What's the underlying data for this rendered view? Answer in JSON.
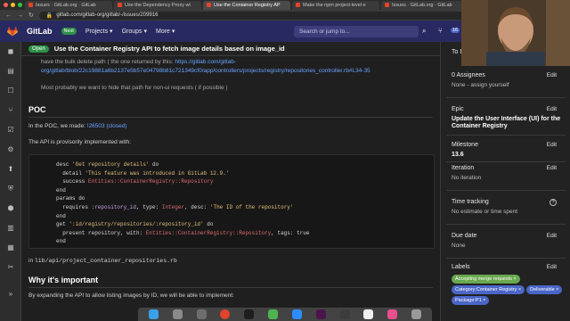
{
  "browser": {
    "tabs": [
      {
        "label": "Issues · GitLab.org · GitLab",
        "active": false
      },
      {
        "label": "Use the Dependency Proxy wi",
        "active": false
      },
      {
        "label": "Use the Container Registry AP",
        "active": true
      },
      {
        "label": "Make the npm project-level e",
        "active": false
      },
      {
        "label": "Issues · GitLab.org · GitLab",
        "active": false
      }
    ],
    "url": "gitlab.com/gitlab-org/gitlab/-/issues/209916"
  },
  "gitlab_nav": {
    "brand": "GitLab",
    "badge": "Next",
    "links": [
      "Projects ▾",
      "Groups ▾",
      "More ▾"
    ],
    "search_placeholder": "Search or jump to...",
    "todo_count": "16"
  },
  "issue_header": {
    "status": "Open",
    "title": "Use the Container Registry API to fetch image details based on image_id"
  },
  "content": {
    "quote_line1": "have the bulk delete path ( the one returned by this:",
    "quote_link": "https://gitlab.com/gitlab-org/gitlab/blob/22c19881a6b2137e5b57e04798b81c721349cf0/app/controllers/projects/registry/repositories_controller.rb#L34-35",
    "quote_line3": "Most probably we want to hide that path for non-ui requests ( if possible )",
    "poc_heading": "POC",
    "poc_text_prefix": "In the POC, we made:",
    "poc_link": "!26503 (closed)",
    "api_text": "The API is provisorily implemented with:",
    "code_lines": [
      [
        {
          "t": "desc ",
          "c": "kw"
        },
        {
          "t": "'Get repository details'",
          "c": "str"
        },
        {
          "t": " do",
          "c": "kw"
        }
      ],
      [
        {
          "t": "  detail ",
          "c": "kw"
        },
        {
          "t": "'This feature was introduced in GitLab 12.9.'",
          "c": "str"
        }
      ],
      [
        {
          "t": "  success ",
          "c": "kw"
        },
        {
          "t": "Entities::ContainerRegistry::Repository",
          "c": "cls"
        }
      ],
      [
        {
          "t": "end",
          "c": "kw"
        }
      ],
      [
        {
          "t": "params do",
          "c": "kw"
        }
      ],
      [
        {
          "t": "  requires ",
          "c": "kw"
        },
        {
          "t": ":repository_id",
          "c": "sym"
        },
        {
          "t": ", type: ",
          "c": "kw"
        },
        {
          "t": "Integer",
          "c": "cls"
        },
        {
          "t": ", desc: ",
          "c": "kw"
        },
        {
          "t": "'The ID of the repository'",
          "c": "str"
        }
      ],
      [
        {
          "t": "end",
          "c": "kw"
        }
      ],
      [
        {
          "t": "get ",
          "c": "kw"
        },
        {
          "t": "':id/registry/repositories/:repository_id'",
          "c": "str"
        },
        {
          "t": " do",
          "c": "kw"
        }
      ],
      [
        {
          "t": "  present repository, with: ",
          "c": "kw"
        },
        {
          "t": "Entities::ContainerRegistry::Repository",
          "c": "cls"
        },
        {
          "t": ", tags: true",
          "c": "kw"
        }
      ],
      [
        {
          "t": "end",
          "c": "kw"
        }
      ]
    ],
    "file_prefix": "in",
    "file_path": "lib/api/project_container_repositories.rb",
    "why_heading": "Why it's important",
    "why_text": "By expanding the API to allow listing images by ID, we will be able to implement:"
  },
  "sidebar": {
    "todo": "To Do",
    "assignees_label": "0 Assignees",
    "assignees_edit": "Edit",
    "assignees_value": "None - assign yourself",
    "epic_label": "Epic",
    "epic_edit": "Edit",
    "epic_value": "Update the User Interface (UI) for the Container Registry",
    "milestone_label": "Milestone",
    "milestone_edit": "Edit",
    "milestone_value": "13.6",
    "iteration_label": "Iteration",
    "iteration_edit": "Edit",
    "iteration_value": "No iteration",
    "time_label": "Time tracking",
    "time_value": "No estimate or time spent",
    "due_label": "Due date",
    "due_edit": "Edit",
    "due_value": "None",
    "labels_label": "Labels",
    "labels_edit": "Edit",
    "labels": [
      {
        "text": "Accepting merge requests ×",
        "color": "#69a84f"
      },
      {
        "text": "Category:Container Registry ×",
        "color": "#4a66c7"
      },
      {
        "text": "Deliverable ×",
        "color": "#4a66c7"
      },
      {
        "text": "Package:P1 ×",
        "color": "#4a66c7"
      }
    ]
  },
  "colors": {
    "gitlab_nav": "#292961",
    "open_badge": "#2e9048",
    "link": "#6aa4ff"
  }
}
